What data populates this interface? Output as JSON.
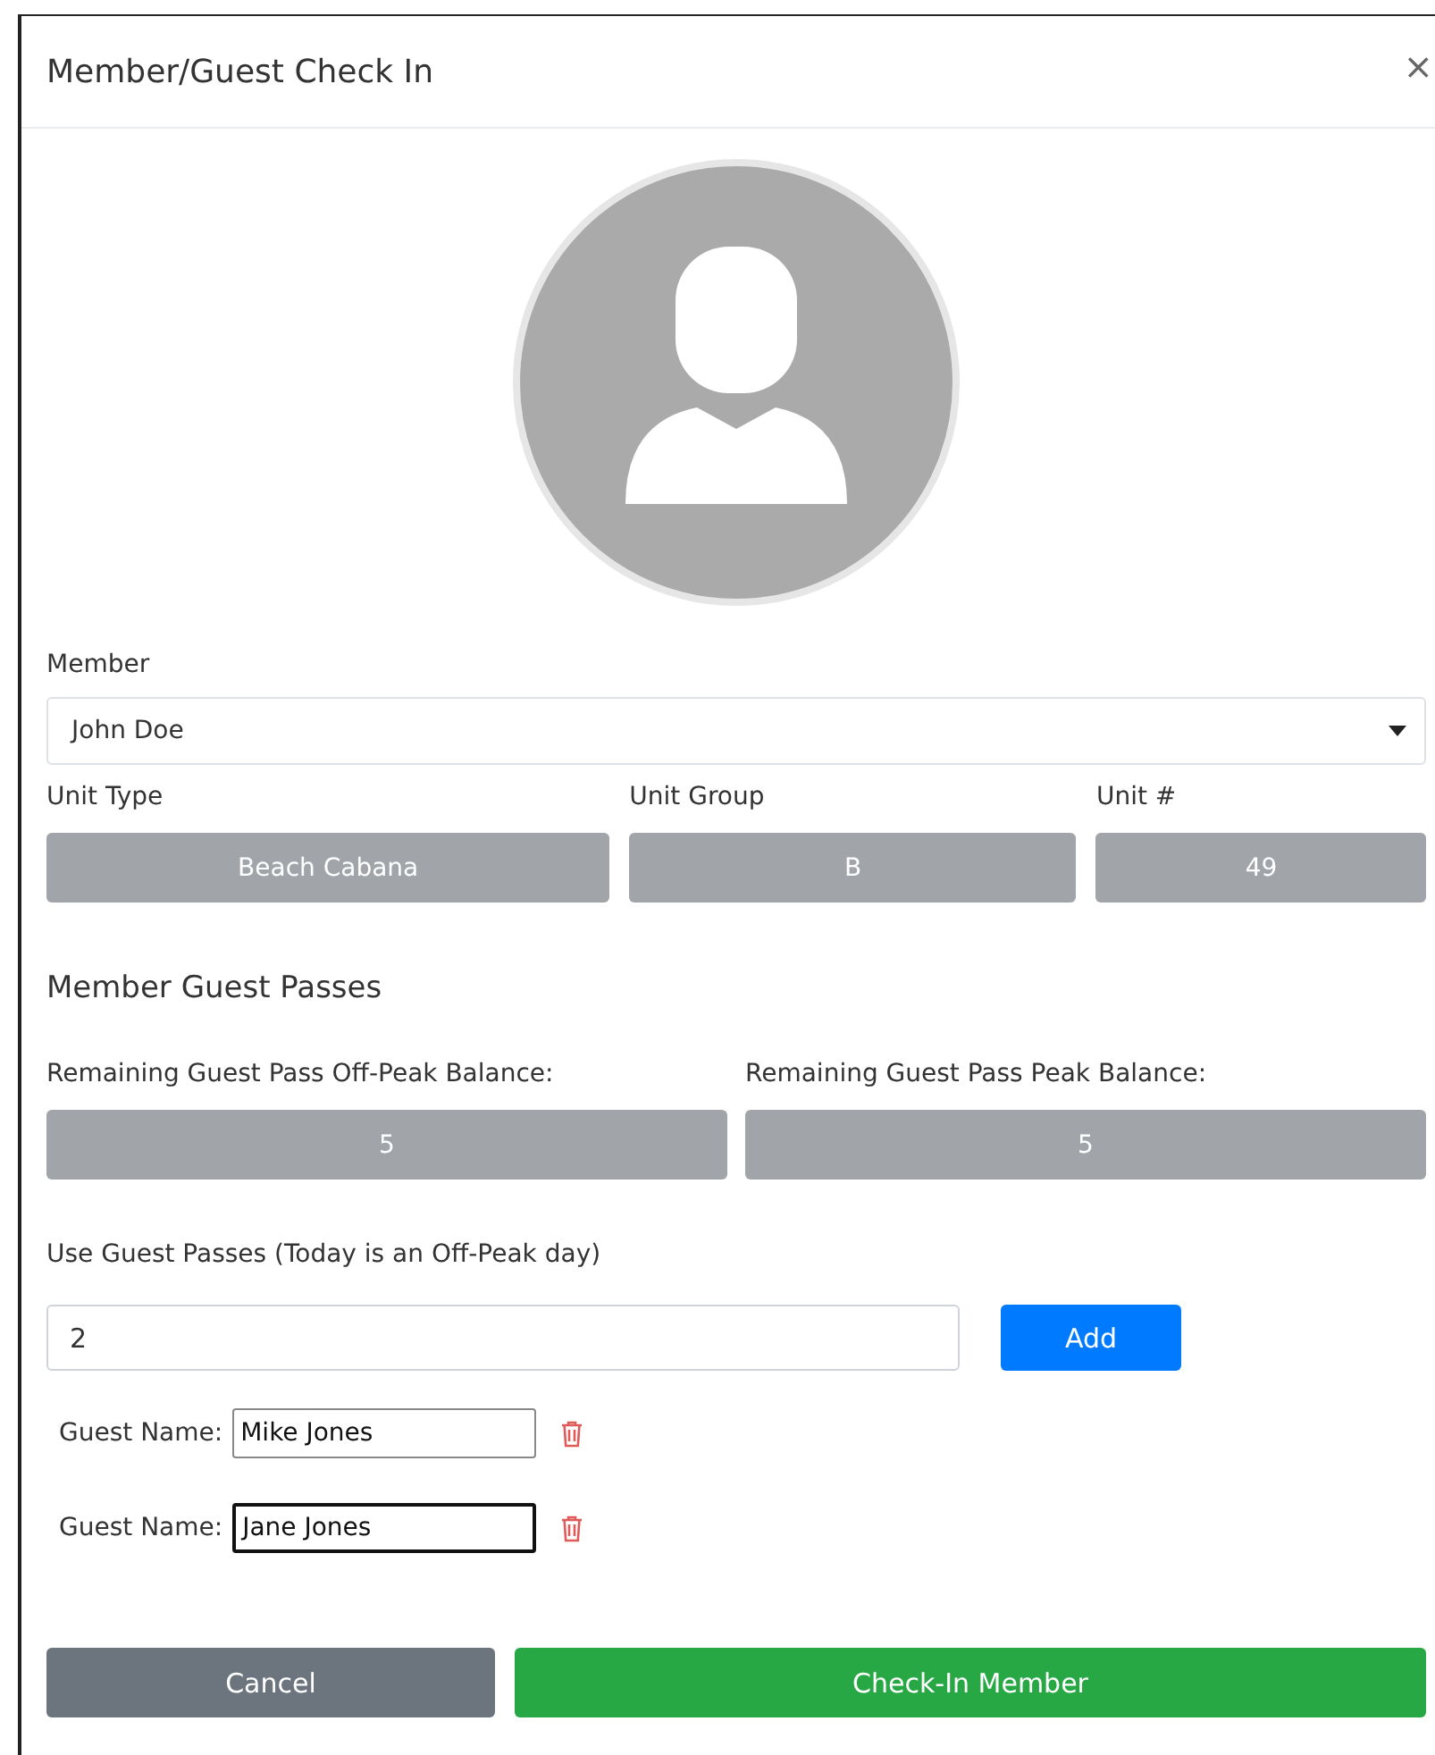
{
  "dialog": {
    "title": "Member/Guest Check In",
    "close": "×"
  },
  "member": {
    "label": "Member",
    "value": "John Doe"
  },
  "units": [
    {
      "label": "Unit Type",
      "value": "Beach Cabana"
    },
    {
      "label": "Unit Group",
      "value": "B"
    },
    {
      "label": "Unit #",
      "value": "49"
    }
  ],
  "section_title": "Member Guest Passes",
  "balances": [
    {
      "label": "Remaining Guest Pass Off-Peak Balance:",
      "value": "5"
    },
    {
      "label": "Remaining Guest Pass Peak Balance:",
      "value": "5"
    }
  ],
  "use_passes": {
    "label": "Use Guest Passes (Today is an Off-Peak day)",
    "value": "2",
    "button": "Add"
  },
  "guests": [
    {
      "label": "Guest Name:",
      "value": "Mike Jones",
      "focused": false
    },
    {
      "label": "Guest Name:",
      "value": "Jane Jones",
      "focused": true
    }
  ],
  "buttons": [
    {
      "label": "Cancel",
      "kind": "secondary"
    },
    {
      "label": "Check-In Member",
      "kind": "success"
    }
  ]
}
